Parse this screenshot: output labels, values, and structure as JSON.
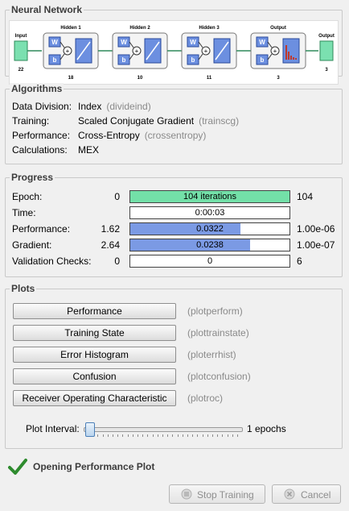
{
  "network": {
    "title": "Neural Network",
    "input_label": "Input",
    "input_size": "22",
    "output_label": "Output",
    "output_size": "3",
    "layers": [
      {
        "title": "Hidden 1",
        "size": "18"
      },
      {
        "title": "Hidden 2",
        "size": "10"
      },
      {
        "title": "Hidden 3",
        "size": "11"
      },
      {
        "title": "Output",
        "size": "3"
      }
    ],
    "w_label": "W",
    "b_label": "b"
  },
  "algorithms": {
    "title": "Algorithms",
    "rows": [
      {
        "label": "Data Division:",
        "value": "Index",
        "fn": "(divideind)"
      },
      {
        "label": "Training:",
        "value": "Scaled Conjugate Gradient",
        "fn": "(trainscg)"
      },
      {
        "label": "Performance:",
        "value": "Cross-Entropy",
        "fn": "(crossentropy)"
      },
      {
        "label": "Calculations:",
        "value": "MEX",
        "fn": ""
      }
    ]
  },
  "progress": {
    "title": "Progress",
    "rows": [
      {
        "label": "Epoch:",
        "start": "0",
        "bar_text": "104 iterations",
        "end": "104",
        "fill": 1.0,
        "color": "#73e0a8"
      },
      {
        "label": "Time:",
        "start": "",
        "bar_text": "0:00:03",
        "end": "",
        "fill": 0.0,
        "color": "#ffffff"
      },
      {
        "label": "Performance:",
        "start": "1.62",
        "bar_text": "0.0322",
        "end": "1.00e-06",
        "fill": 0.69,
        "color": "#7b9ae4"
      },
      {
        "label": "Gradient:",
        "start": "2.64",
        "bar_text": "0.0238",
        "end": "1.00e-07",
        "fill": 0.75,
        "color": "#7b9ae4"
      },
      {
        "label": "Validation Checks:",
        "start": "0",
        "bar_text": "0",
        "end": "6",
        "fill": 0.0,
        "color": "#ffffff"
      }
    ]
  },
  "plots": {
    "title": "Plots",
    "buttons": [
      {
        "label": "Performance",
        "fn": "(plotperform)"
      },
      {
        "label": "Training State",
        "fn": "(plottrainstate)"
      },
      {
        "label": "Error Histogram",
        "fn": "(ploterrhist)"
      },
      {
        "label": "Confusion",
        "fn": "(plotconfusion)"
      },
      {
        "label": "Receiver Operating Characteristic",
        "fn": "(plotroc)"
      }
    ],
    "interval_label": "Plot Interval:",
    "interval_value": "1 epochs",
    "interval_level": 0.0
  },
  "status": {
    "text": "Opening Performance Plot",
    "icon": "checkmark-icon",
    "color": "#2e8b2e"
  },
  "actions": {
    "stop_label": "Stop Training",
    "cancel_label": "Cancel"
  }
}
